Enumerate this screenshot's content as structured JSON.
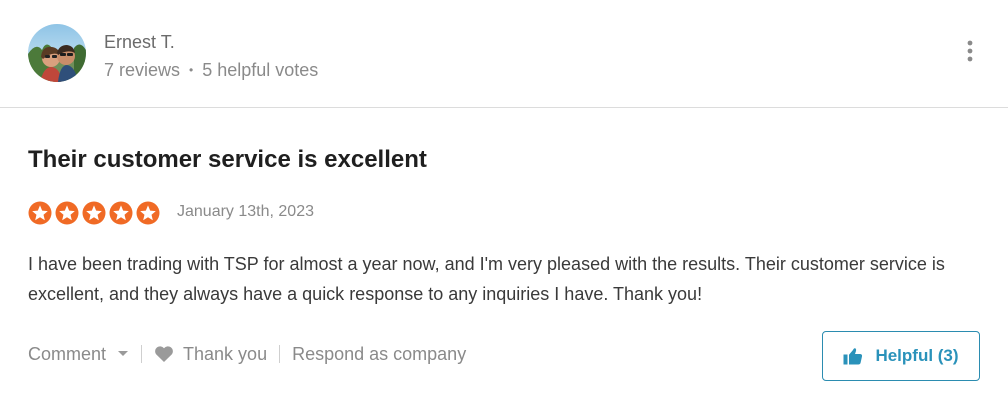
{
  "reviewer": {
    "name": "Ernest T.",
    "reviews": "7 reviews",
    "separator": "•",
    "helpful_votes": "5 helpful votes"
  },
  "review": {
    "title": "Their customer service is excellent",
    "rating": 5,
    "rating_max": 5,
    "date": "January 13th, 2023",
    "body": "I have been trading with TSP for almost a year now, and I'm very pleased with the results. Their customer service is excellent, and they always have a quick response to any inquiries I have. Thank you!"
  },
  "actions": {
    "comment": "Comment",
    "thank_you": "Thank you",
    "respond": "Respond as company",
    "helpful": "Helpful (3)"
  },
  "colors": {
    "star": "#f06a25",
    "accent": "#2a92ba"
  },
  "icons": {
    "menu": "kebab-menu-icon",
    "caret": "chevron-down-icon",
    "heart": "heart-icon",
    "thumb": "thumbs-up-icon",
    "star": "star-icon"
  }
}
